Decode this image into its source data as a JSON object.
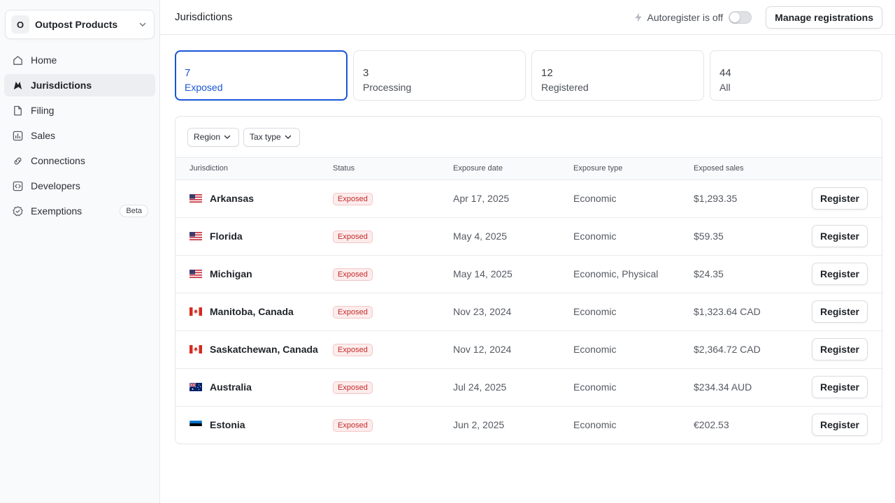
{
  "org": {
    "initial": "O",
    "name": "Outpost Products"
  },
  "nav": [
    {
      "id": "home",
      "label": "Home",
      "icon": "home-icon",
      "active": false
    },
    {
      "id": "jurisdictions",
      "label": "Jurisdictions",
      "icon": "jurisdictions-icon",
      "active": true
    },
    {
      "id": "filing",
      "label": "Filing",
      "icon": "document-icon",
      "active": false
    },
    {
      "id": "sales",
      "label": "Sales",
      "icon": "bar-chart-icon",
      "active": false
    },
    {
      "id": "connections",
      "label": "Connections",
      "icon": "link-icon",
      "active": false
    },
    {
      "id": "developers",
      "label": "Developers",
      "icon": "code-icon",
      "active": false
    },
    {
      "id": "exemptions",
      "label": "Exemptions",
      "icon": "badge-check-icon",
      "active": false,
      "badge": "Beta"
    }
  ],
  "header": {
    "title": "Jurisdictions",
    "autoregister_label": "Autoregister is off",
    "autoregister_on": false,
    "manage_label": "Manage registrations"
  },
  "cards": [
    {
      "count": "7",
      "label": "Exposed",
      "active": true
    },
    {
      "count": "3",
      "label": "Processing",
      "active": false
    },
    {
      "count": "12",
      "label": "Registered",
      "active": false
    },
    {
      "count": "44",
      "label": "All",
      "active": false
    }
  ],
  "filters": [
    {
      "id": "region",
      "label": "Region"
    },
    {
      "id": "tax-type",
      "label": "Tax type"
    }
  ],
  "table": {
    "columns": [
      "Jurisdiction",
      "Status",
      "Exposure date",
      "Exposure type",
      "Exposed sales"
    ],
    "action_label": "Register",
    "rows": [
      {
        "name": "Arkansas",
        "flag": "us",
        "status": "Exposed",
        "date": "Apr 17, 2025",
        "type": "Economic",
        "sales": "$1,293.35"
      },
      {
        "name": "Florida",
        "flag": "us",
        "status": "Exposed",
        "date": "May 4, 2025",
        "type": "Economic",
        "sales": "$59.35"
      },
      {
        "name": "Michigan",
        "flag": "us",
        "status": "Exposed",
        "date": "May 14, 2025",
        "type": "Economic, Physical",
        "sales": "$24.35"
      },
      {
        "name": "Manitoba, Canada",
        "flag": "ca",
        "status": "Exposed",
        "date": "Nov 23, 2024",
        "type": "Economic",
        "sales": "$1,323.64 CAD"
      },
      {
        "name": "Saskatchewan, Canada",
        "flag": "ca",
        "status": "Exposed",
        "date": "Nov 12, 2024",
        "type": "Economic",
        "sales": "$2,364.72 CAD"
      },
      {
        "name": "Australia",
        "flag": "au",
        "status": "Exposed",
        "date": "Jul 24, 2025",
        "type": "Economic",
        "sales": "$234.34 AUD"
      },
      {
        "name": "Estonia",
        "flag": "ee",
        "status": "Exposed",
        "date": "Jun 2, 2025",
        "type": "Economic",
        "sales": "€202.53"
      }
    ]
  },
  "colors": {
    "accent": "#1a55d8",
    "danger": "#c42b2b",
    "danger_bg": "#fdecec"
  }
}
